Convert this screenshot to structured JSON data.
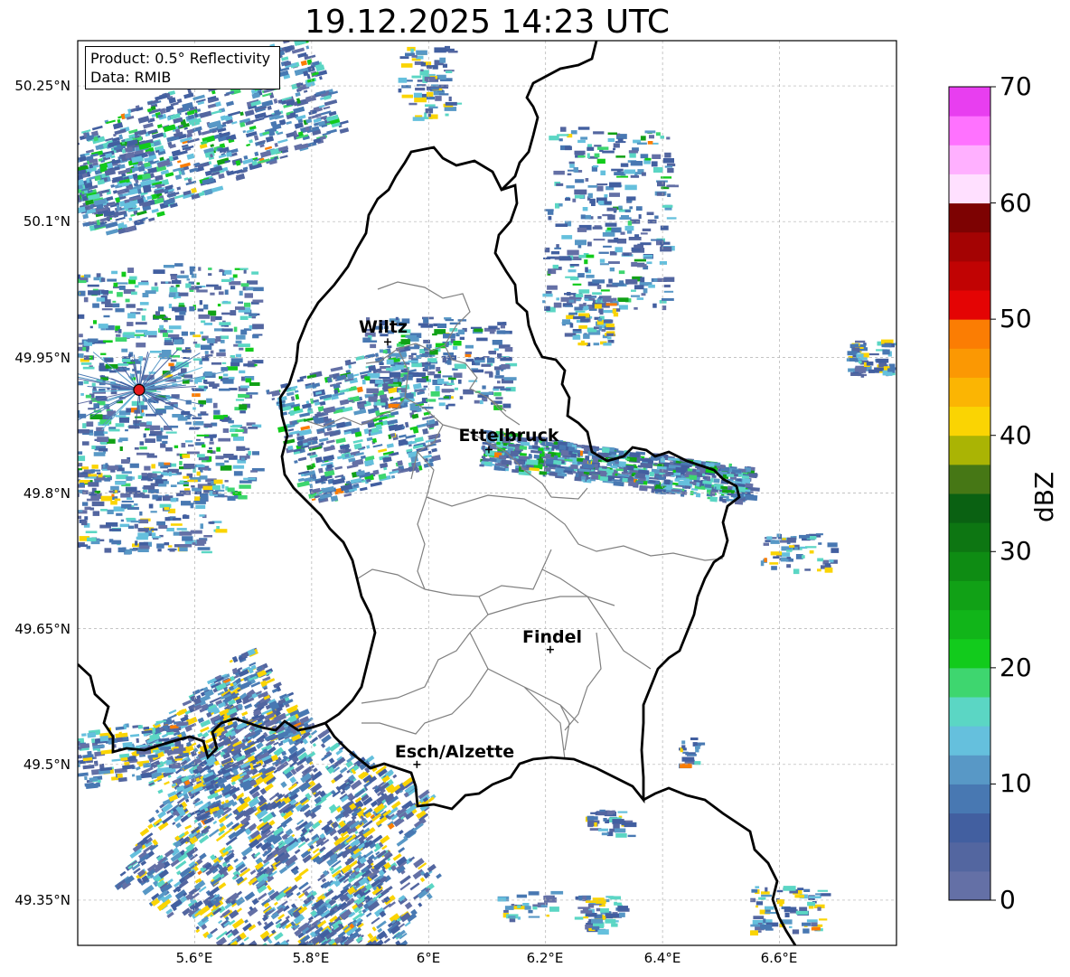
{
  "title": "19.12.2025 14:23 UTC",
  "info": {
    "product": "Product: 0.5° Reflectivity",
    "source": "Data: RMIB"
  },
  "map": {
    "lon_range": [
      5.4,
      6.8
    ],
    "lat_range": [
      49.3,
      50.3
    ],
    "lat_ticks": [
      "50.25°N",
      "50.1°N",
      "49.95°N",
      "49.8°N",
      "49.65°N",
      "49.5°N",
      "49.35°N"
    ],
    "lon_ticks": [
      "5.6°E",
      "5.8°E",
      "6°E",
      "6.2°E",
      "6.4°E",
      "6.6°E"
    ],
    "gridlines": true,
    "cities": [
      {
        "name": "Wiltz",
        "lon": 5.93,
        "lat": 49.967
      },
      {
        "name": "Ettelbruck",
        "lon": 6.103,
        "lat": 49.848
      },
      {
        "name": "Findel",
        "lon": 6.208,
        "lat": 49.627
      },
      {
        "name": "Esch/Alzette",
        "lon": 5.98,
        "lat": 49.5
      }
    ],
    "radar_site": {
      "lon": 5.505,
      "lat": 49.914,
      "color": "#e41a1c"
    },
    "border_color": "#000000",
    "canton_border_color": "#808080"
  },
  "colorbar": {
    "label": "dBZ",
    "ticks": [
      "70",
      "60",
      "50",
      "40",
      "30",
      "20",
      "10",
      "0"
    ],
    "range": [
      0,
      70
    ],
    "colors": [
      "#6470a6",
      "#5366a0",
      "#425fa0",
      "#4878b2",
      "#5898c6",
      "#65c0dd",
      "#5bd6c4",
      "#3ed66f",
      "#12cb1c",
      "#11b519",
      "#11a116",
      "#0e8c13",
      "#0d7612",
      "#0a6112",
      "#467715",
      "#aab404",
      "#fad403",
      "#fbb503",
      "#fb9803",
      "#fb7d03",
      "#e40404",
      "#c10303",
      "#a40303",
      "#7d0202",
      "#ffe0ff",
      "#ffb0ff",
      "#ff72ff",
      "#e83ef0"
    ]
  }
}
